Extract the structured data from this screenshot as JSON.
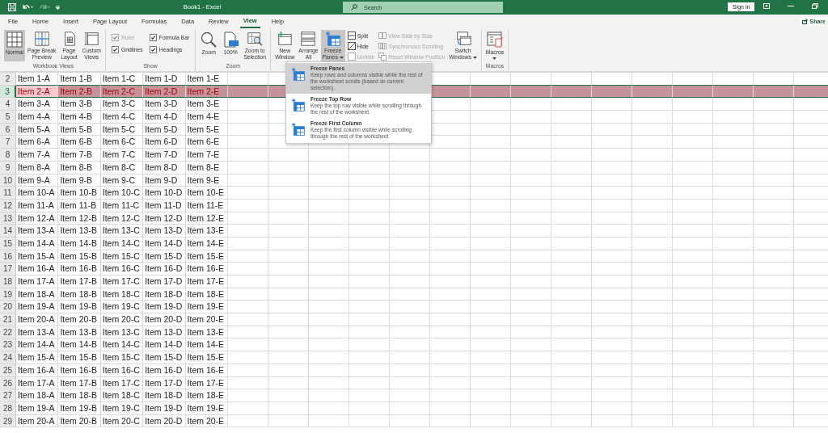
{
  "title_bar": {
    "title": "Book1 - Excel",
    "search": {
      "placeholder": "Search"
    },
    "sign_in": "Sign in"
  },
  "tabs": [
    {
      "label": "File",
      "selected": false
    },
    {
      "label": "Home",
      "selected": false
    },
    {
      "label": "Insert",
      "selected": false
    },
    {
      "label": "Page Layout",
      "selected": false
    },
    {
      "label": "Formulas",
      "selected": false
    },
    {
      "label": "Data",
      "selected": false
    },
    {
      "label": "Review",
      "selected": false
    },
    {
      "label": "View",
      "selected": true
    },
    {
      "label": "Help",
      "selected": false
    }
  ],
  "share": "Share",
  "ribbon": {
    "groups": [
      {
        "label": "Workbook Views",
        "items": [
          {
            "kind": "large",
            "label": "Normal",
            "selected": true,
            "dropdown": false
          },
          {
            "kind": "large",
            "label": "Page Break\nPreview",
            "selected": false,
            "dropdown": false
          },
          {
            "kind": "large",
            "label": "Page\nLayout",
            "selected": false,
            "dropdown": false
          },
          {
            "kind": "large",
            "label": "Custom\nViews",
            "selected": false,
            "dropdown": false
          }
        ]
      },
      {
        "label": "Show",
        "items": [
          {
            "kind": "checkbox",
            "label": "Ruler",
            "checked": true,
            "disabled": true
          },
          {
            "kind": "checkbox",
            "label": "Formula Bar",
            "checked": true,
            "disabled": false
          },
          {
            "kind": "checkbox",
            "label": "Gridlines",
            "checked": true,
            "disabled": false
          },
          {
            "kind": "checkbox",
            "label": "Headings",
            "checked": true,
            "disabled": false
          }
        ]
      },
      {
        "label": "Zoom",
        "items": [
          {
            "kind": "large",
            "label": "Zoom",
            "selected": false,
            "dropdown": false
          },
          {
            "kind": "large",
            "label": "100%",
            "selected": false,
            "dropdown": false
          },
          {
            "kind": "large",
            "label": "Zoom to\nSelection",
            "selected": false,
            "dropdown": false
          }
        ]
      },
      {
        "items": [
          {
            "kind": "large",
            "label": "New\nWindow",
            "selected": false,
            "dropdown": false
          },
          {
            "kind": "large",
            "label": "Arrange\nAll",
            "selected": false,
            "dropdown": false
          },
          {
            "kind": "large",
            "label": "Freeze\nPanes",
            "selected": true,
            "dropdown": true
          },
          {
            "kind": "small",
            "label": "Split",
            "disabled": false
          },
          {
            "kind": "small",
            "label": "Hide",
            "disabled": false
          },
          {
            "kind": "small",
            "label": "Unhide",
            "disabled": true
          },
          {
            "kind": "small",
            "label": "View Side by Side",
            "disabled": true
          },
          {
            "kind": "small",
            "label": "Synchronous Scrolling",
            "disabled": true
          },
          {
            "kind": "small",
            "label": "Reset Window Position",
            "disabled": true
          },
          {
            "kind": "large",
            "label": "Switch\nWindows",
            "selected": false,
            "dropdown": true
          }
        ]
      },
      {
        "label": "Macros",
        "items": [
          {
            "kind": "large",
            "label": "Macros",
            "selected": false,
            "dropdown": true
          }
        ]
      }
    ]
  },
  "freeze_menu": [
    {
      "title": "Freeze Panes",
      "description": "Keep rows and columns visible while the rest of the worksheet scrolls (based on current selection).",
      "selected": true
    },
    {
      "title": "Freeze Top Row",
      "description": "Keep the top row visible while scrolling through the rest of the worksheet.",
      "selected": false
    },
    {
      "title": "Freeze First Column",
      "description": "Keep the first column visible while scrolling through the rest of the worksheet.",
      "selected": false
    }
  ],
  "sheet": {
    "rows": [
      {
        "number": "2",
        "selected": false,
        "cells": [
          {
            "text": "Item 1-A",
            "active": false
          },
          {
            "text": "Item 1-B",
            "active": false
          },
          {
            "text": "Item 1-C",
            "active": false
          },
          {
            "text": "Item 1-D",
            "active": false
          },
          {
            "text": "Item 1-E",
            "active": false
          }
        ]
      },
      {
        "number": "3",
        "selected": true,
        "cells": [
          {
            "text": "Item 2-A",
            "active": true
          },
          {
            "text": "Item 2-B",
            "active": false
          },
          {
            "text": "Item 2-C",
            "active": false
          },
          {
            "text": "Item 2-D",
            "active": false
          },
          {
            "text": "Item 2-E",
            "active": false
          }
        ]
      },
      {
        "number": "4",
        "selected": false,
        "cells": [
          {
            "text": "Item 3-A",
            "active": false
          },
          {
            "text": "Item 3-B",
            "active": false
          },
          {
            "text": "Item 3-C",
            "active": false
          },
          {
            "text": "Item 3-D",
            "active": false
          },
          {
            "text": "Item 3-E",
            "active": false
          }
        ]
      },
      {
        "number": "5",
        "selected": false,
        "cells": [
          {
            "text": "Item 4-A",
            "active": false
          },
          {
            "text": "Item 4-B",
            "active": false
          },
          {
            "text": "Item 4-C",
            "active": false
          },
          {
            "text": "Item 4-D",
            "active": false
          },
          {
            "text": "Item 4-E",
            "active": false
          }
        ]
      },
      {
        "number": "6",
        "selected": false,
        "cells": [
          {
            "text": "Item 5-A",
            "active": false
          },
          {
            "text": "Item 5-B",
            "active": false
          },
          {
            "text": "Item 5-C",
            "active": false
          },
          {
            "text": "Item 5-D",
            "active": false
          },
          {
            "text": "Item 5-E",
            "active": false
          }
        ]
      },
      {
        "number": "7",
        "selected": false,
        "cells": [
          {
            "text": "Item 6-A",
            "active": false
          },
          {
            "text": "Item 6-B",
            "active": false
          },
          {
            "text": "Item 6-C",
            "active": false
          },
          {
            "text": "Item 6-D",
            "active": false
          },
          {
            "text": "Item 6-E",
            "active": false
          }
        ]
      },
      {
        "number": "8",
        "selected": false,
        "cells": [
          {
            "text": "Item 7-A",
            "active": false
          },
          {
            "text": "Item 7-B",
            "active": false
          },
          {
            "text": "Item 7-C",
            "active": false
          },
          {
            "text": "Item 7-D",
            "active": false
          },
          {
            "text": "Item 7-E",
            "active": false
          }
        ]
      },
      {
        "number": "9",
        "selected": false,
        "cells": [
          {
            "text": "Item 8-A",
            "active": false
          },
          {
            "text": "Item 8-B",
            "active": false
          },
          {
            "text": "Item 8-C",
            "active": false
          },
          {
            "text": "Item 8-D",
            "active": false
          },
          {
            "text": "Item 8-E",
            "active": false
          }
        ]
      },
      {
        "number": "10",
        "selected": false,
        "cells": [
          {
            "text": "Item 9-A",
            "active": false
          },
          {
            "text": "Item 9-B",
            "active": false
          },
          {
            "text": "Item 9-C",
            "active": false
          },
          {
            "text": "Item 9-D",
            "active": false
          },
          {
            "text": "Item 9-E",
            "active": false
          }
        ]
      },
      {
        "number": "11",
        "selected": false,
        "cells": [
          {
            "text": "Item 10-A",
            "active": false
          },
          {
            "text": "Item 10-B",
            "active": false
          },
          {
            "text": "Item 10-C",
            "active": false
          },
          {
            "text": "Item 10-D",
            "active": false
          },
          {
            "text": "Item 10-E",
            "active": false
          }
        ]
      },
      {
        "number": "12",
        "selected": false,
        "cells": [
          {
            "text": "Item 11-A",
            "active": false
          },
          {
            "text": "Item 11-B",
            "active": false
          },
          {
            "text": "Item 11-C",
            "active": false
          },
          {
            "text": "Item 11-D",
            "active": false
          },
          {
            "text": "Item 11-E",
            "active": false
          }
        ]
      },
      {
        "number": "13",
        "selected": false,
        "cells": [
          {
            "text": "Item 12-A",
            "active": false
          },
          {
            "text": "Item 12-B",
            "active": false
          },
          {
            "text": "Item 12-C",
            "active": false
          },
          {
            "text": "Item 12-D",
            "active": false
          },
          {
            "text": "Item 12-E",
            "active": false
          }
        ]
      },
      {
        "number": "14",
        "selected": false,
        "cells": [
          {
            "text": "Item 13-A",
            "active": false
          },
          {
            "text": "Item 13-B",
            "active": false
          },
          {
            "text": "Item 13-C",
            "active": false
          },
          {
            "text": "Item 13-D",
            "active": false
          },
          {
            "text": "Item 13-E",
            "active": false
          }
        ]
      },
      {
        "number": "15",
        "selected": false,
        "cells": [
          {
            "text": "Item 14-A",
            "active": false
          },
          {
            "text": "Item 14-B",
            "active": false
          },
          {
            "text": "Item 14-C",
            "active": false
          },
          {
            "text": "Item 14-D",
            "active": false
          },
          {
            "text": "Item 14-E",
            "active": false
          }
        ]
      },
      {
        "number": "16",
        "selected": false,
        "cells": [
          {
            "text": "Item 15-A",
            "active": false
          },
          {
            "text": "Item 15-B",
            "active": false
          },
          {
            "text": "Item 15-C",
            "active": false
          },
          {
            "text": "Item 15-D",
            "active": false
          },
          {
            "text": "Item 15-E",
            "active": false
          }
        ]
      },
      {
        "number": "17",
        "selected": false,
        "cells": [
          {
            "text": "Item 16-A",
            "active": false
          },
          {
            "text": "Item 16-B",
            "active": false
          },
          {
            "text": "Item 16-C",
            "active": false
          },
          {
            "text": "Item 16-D",
            "active": false
          },
          {
            "text": "Item 16-E",
            "active": false
          }
        ]
      },
      {
        "number": "18",
        "selected": false,
        "cells": [
          {
            "text": "Item 17-A",
            "active": false
          },
          {
            "text": "Item 17-B",
            "active": false
          },
          {
            "text": "Item 17-C",
            "active": false
          },
          {
            "text": "Item 17-D",
            "active": false
          },
          {
            "text": "Item 17-E",
            "active": false
          }
        ]
      },
      {
        "number": "19",
        "selected": false,
        "cells": [
          {
            "text": "Item 18-A",
            "active": false
          },
          {
            "text": "Item 18-B",
            "active": false
          },
          {
            "text": "Item 18-C",
            "active": false
          },
          {
            "text": "Item 18-D",
            "active": false
          },
          {
            "text": "Item 18-E",
            "active": false
          }
        ]
      },
      {
        "number": "20",
        "selected": false,
        "cells": [
          {
            "text": "Item 19-A",
            "active": false
          },
          {
            "text": "Item 19-B",
            "active": false
          },
          {
            "text": "Item 19-C",
            "active": false
          },
          {
            "text": "Item 19-D",
            "active": false
          },
          {
            "text": "Item 19-E",
            "active": false
          }
        ]
      },
      {
        "number": "21",
        "selected": false,
        "cells": [
          {
            "text": "Item 20-A",
            "active": false
          },
          {
            "text": "Item 20-B",
            "active": false
          },
          {
            "text": "Item 20-C",
            "active": false
          },
          {
            "text": "Item 20-D",
            "active": false
          },
          {
            "text": "Item 20-E",
            "active": false
          }
        ]
      },
      {
        "number": "22",
        "selected": false,
        "cells": [
          {
            "text": "Item 13-A",
            "active": false
          },
          {
            "text": "Item 13-B",
            "active": false
          },
          {
            "text": "Item 13-C",
            "active": false
          },
          {
            "text": "Item 13-D",
            "active": false
          },
          {
            "text": "Item 13-E",
            "active": false
          }
        ]
      },
      {
        "number": "23",
        "selected": false,
        "cells": [
          {
            "text": "Item 14-A",
            "active": false
          },
          {
            "text": "Item 14-B",
            "active": false
          },
          {
            "text": "Item 14-C",
            "active": false
          },
          {
            "text": "Item 14-D",
            "active": false
          },
          {
            "text": "Item 14-E",
            "active": false
          }
        ]
      },
      {
        "number": "24",
        "selected": false,
        "cells": [
          {
            "text": "Item 15-A",
            "active": false
          },
          {
            "text": "Item 15-B",
            "active": false
          },
          {
            "text": "Item 15-C",
            "active": false
          },
          {
            "text": "Item 15-D",
            "active": false
          },
          {
            "text": "Item 15-E",
            "active": false
          }
        ]
      },
      {
        "number": "25",
        "selected": false,
        "cells": [
          {
            "text": "Item 16-A",
            "active": false
          },
          {
            "text": "Item 16-B",
            "active": false
          },
          {
            "text": "Item 16-C",
            "active": false
          },
          {
            "text": "Item 16-D",
            "active": false
          },
          {
            "text": "Item 16-E",
            "active": false
          }
        ]
      },
      {
        "number": "26",
        "selected": false,
        "cells": [
          {
            "text": "Item 17-A",
            "active": false
          },
          {
            "text": "Item 17-B",
            "active": false
          },
          {
            "text": "Item 17-C",
            "active": false
          },
          {
            "text": "Item 17-D",
            "active": false
          },
          {
            "text": "Item 17-E",
            "active": false
          }
        ]
      },
      {
        "number": "27",
        "selected": false,
        "cells": [
          {
            "text": "Item 18-A",
            "active": false
          },
          {
            "text": "Item 18-B",
            "active": false
          },
          {
            "text": "Item 18-C",
            "active": false
          },
          {
            "text": "Item 18-D",
            "active": false
          },
          {
            "text": "Item 18-E",
            "active": false
          }
        ]
      },
      {
        "number": "28",
        "selected": false,
        "cells": [
          {
            "text": "Item 19-A",
            "active": false
          },
          {
            "text": "Item 19-B",
            "active": false
          },
          {
            "text": "Item 19-C",
            "active": false
          },
          {
            "text": "Item 19-D",
            "active": false
          },
          {
            "text": "Item 19-E",
            "active": false
          }
        ]
      },
      {
        "number": "29",
        "selected": false,
        "cells": [
          {
            "text": "Item 20-A",
            "active": false
          },
          {
            "text": "Item 20-B",
            "active": false
          },
          {
            "text": "Item 20-C",
            "active": false
          },
          {
            "text": "Item 20-D",
            "active": false
          },
          {
            "text": "Item 20-E",
            "active": false
          }
        ]
      }
    ]
  }
}
